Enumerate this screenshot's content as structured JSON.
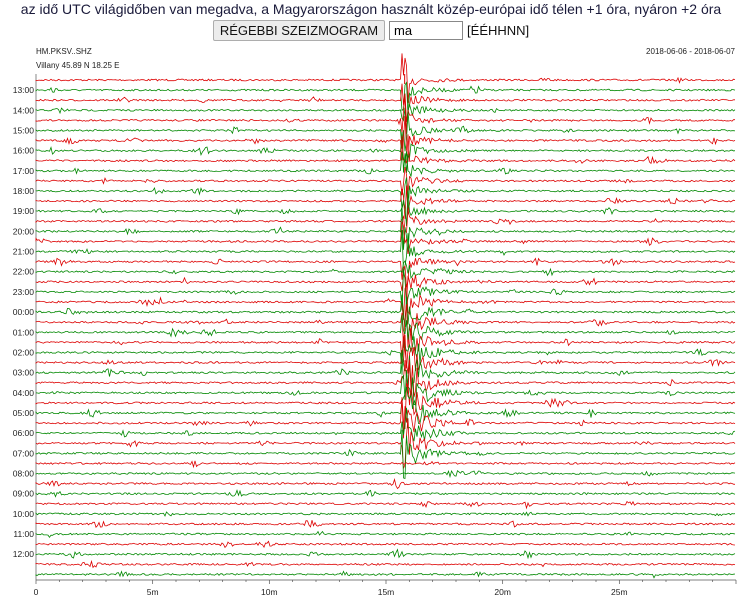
{
  "notice": "az idő UTC világidőben van megadva, a Magyarországon használt közép-európai idő télen +1 óra, nyáron +2 óra",
  "controls": {
    "older_button_label": "RÉGEBBI SZEIZMOGRAM",
    "date_value": "ma",
    "date_format_hint": "[ÉÉHHNN]"
  },
  "seismogram": {
    "station_code": "HM.PKSV..SHZ",
    "location": "Villany  45.89 N 18.25 E",
    "date_range": "2018-06-06 - 2018-06-07",
    "hour_labels": [
      "13:00",
      "14:00",
      "15:00",
      "16:00",
      "17:00",
      "18:00",
      "19:00",
      "20:00",
      "21:00",
      "22:00",
      "23:00",
      "00:00",
      "01:00",
      "02:00",
      "03:00",
      "04:00",
      "05:00",
      "06:00",
      "07:00",
      "08:00",
      "09:00",
      "10:00",
      "11:00",
      "12:00"
    ],
    "minute_ticks": [
      "0",
      "5m",
      "10m",
      "15m",
      "20m",
      "25m"
    ],
    "trace_colors": [
      "#dd0000",
      "#008800"
    ],
    "event_minute": 15.8
  }
}
